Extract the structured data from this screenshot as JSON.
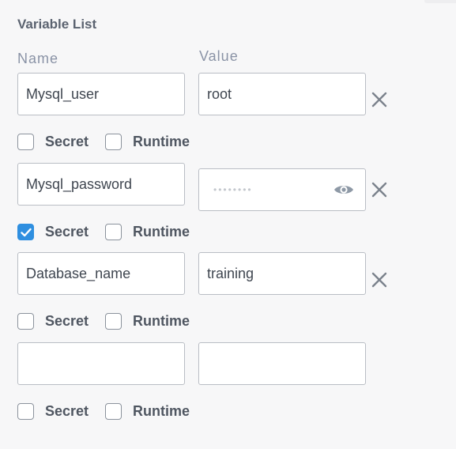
{
  "panel": {
    "title": "Variable List"
  },
  "columns": {
    "name": "Name",
    "value": "Value"
  },
  "labels": {
    "secret": "Secret",
    "runtime": "Runtime"
  },
  "variables": [
    {
      "name": "Mysql_user",
      "value": "root",
      "masked": false,
      "secret": false,
      "runtime": false,
      "removable": true
    },
    {
      "name": "Mysql_password",
      "value": "••••••••",
      "masked": true,
      "secret": true,
      "runtime": false,
      "removable": true
    },
    {
      "name": "Database_name",
      "value": "training",
      "masked": false,
      "secret": false,
      "runtime": false,
      "removable": true
    },
    {
      "name": "",
      "value": "",
      "masked": false,
      "secret": false,
      "runtime": false,
      "removable": false
    }
  ],
  "icons": {
    "remove": "close-icon",
    "reveal": "eye-icon",
    "checked": "checkmark-icon"
  },
  "colors": {
    "accent": "#2f8fe0",
    "text": "#3f4650",
    "label": "#8a93a6",
    "border": "#b9bdc4"
  }
}
